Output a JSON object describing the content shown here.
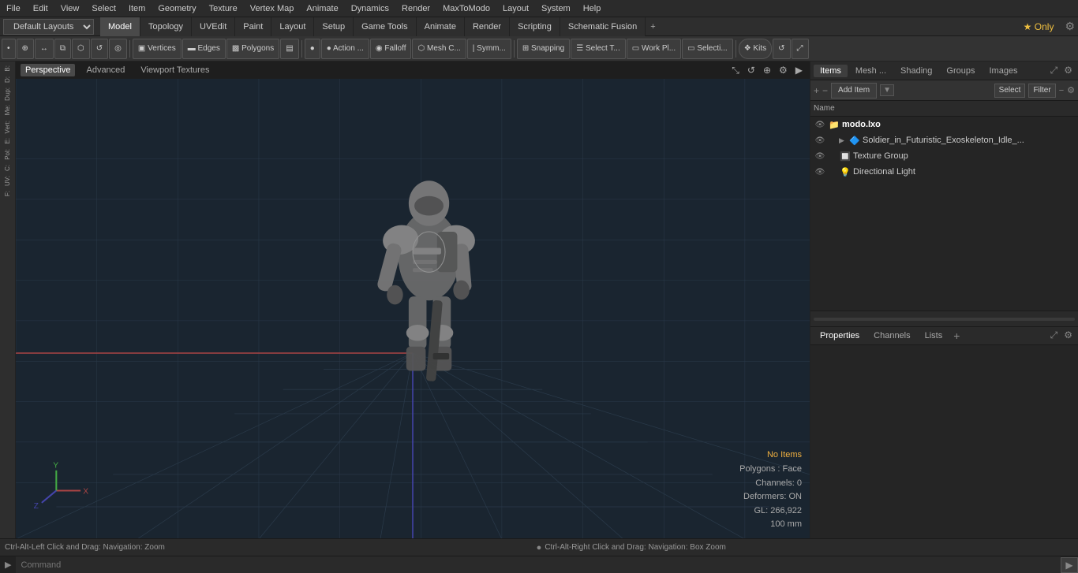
{
  "menubar": {
    "items": [
      "File",
      "Edit",
      "View",
      "Select",
      "Item",
      "Geometry",
      "Texture",
      "Vertex Map",
      "Animate",
      "Dynamics",
      "Render",
      "MaxToModo",
      "Layout",
      "System",
      "Help"
    ]
  },
  "layoutbar": {
    "dropdown_label": "Default Layouts",
    "tabs": [
      "Model",
      "Topology",
      "UVEdit",
      "Paint",
      "Layout",
      "Setup",
      "Game Tools",
      "Animate",
      "Render",
      "Scripting",
      "Schematic Fusion"
    ],
    "active_tab": "Model",
    "star_label": "★ Only",
    "plus_label": "+"
  },
  "toolbar": {
    "buttons": [
      {
        "label": "•",
        "icon": "dot"
      },
      {
        "label": "⊕",
        "icon": "crosshair"
      },
      {
        "label": "⋯",
        "icon": "dots"
      },
      {
        "label": "⧉",
        "icon": "box-select"
      },
      {
        "label": "⬡",
        "icon": "hex"
      },
      {
        "label": "⟳",
        "icon": "rotate"
      },
      {
        "label": "⬤",
        "icon": "circle"
      },
      {
        "label": "▣ Vertices",
        "icon": "vertices",
        "active": false
      },
      {
        "label": "▬ Edges",
        "icon": "edges",
        "active": false
      },
      {
        "label": "▩ Polygons",
        "icon": "polygons",
        "active": false
      },
      {
        "label": "▤",
        "icon": "quad"
      },
      {
        "label": "●",
        "icon": "dot2"
      },
      {
        "label": "● Action ...",
        "icon": "action"
      },
      {
        "label": "◉ Falloff",
        "icon": "falloff"
      },
      {
        "label": "⬡ Mesh C...",
        "icon": "mesh"
      },
      {
        "label": "| Symm...",
        "icon": "symmetry"
      },
      {
        "label": "⊞ Snapping",
        "icon": "snapping"
      },
      {
        "label": "☰ Select T...",
        "icon": "select-t"
      },
      {
        "label": "▭ Work Pl...",
        "icon": "workplane"
      },
      {
        "label": "▭ Selecti...",
        "icon": "selection"
      },
      {
        "label": "❖ Kits",
        "icon": "kits"
      },
      {
        "label": "⟳",
        "icon": "rotate2"
      },
      {
        "label": "⤢",
        "icon": "maximize"
      }
    ]
  },
  "left_toolbar": {
    "items": [
      "B:",
      "D:",
      "Dup:",
      "Me:",
      "Vert:",
      "E:",
      "Pol:",
      "C:",
      "UV:",
      "F:"
    ]
  },
  "viewport": {
    "tabs": [
      "Perspective",
      "Advanced",
      "Viewport Textures"
    ],
    "active_tab": "Perspective",
    "status": {
      "no_items": "No Items",
      "polygons": "Polygons : Face",
      "channels": "Channels: 0",
      "deformers": "Deformers: ON",
      "gl": "GL: 266,922",
      "size": "100 mm"
    }
  },
  "items_panel": {
    "tabs": [
      "Items",
      "Mesh ...",
      "Shading",
      "Groups",
      "Images"
    ],
    "active_tab": "Items",
    "add_item_label": "Add Item",
    "select_label": "Select",
    "filter_label": "Filter",
    "col_header": "Name",
    "items": [
      {
        "id": 1,
        "indent": 0,
        "has_arrow": false,
        "icon": "📁",
        "name": "modo.lxo",
        "bold": true,
        "eye": true
      },
      {
        "id": 2,
        "indent": 1,
        "has_arrow": true,
        "icon": "🔷",
        "name": "Soldier_in_Futuristic_Exoskeleton_Idle_...",
        "bold": false,
        "eye": true
      },
      {
        "id": 3,
        "indent": 1,
        "has_arrow": false,
        "icon": "🔲",
        "name": "Texture Group",
        "bold": false,
        "eye": true
      },
      {
        "id": 4,
        "indent": 1,
        "has_arrow": false,
        "icon": "💡",
        "name": "Directional Light",
        "bold": false,
        "eye": true
      }
    ]
  },
  "properties_panel": {
    "tabs": [
      "Properties",
      "Channels",
      "Lists"
    ],
    "active_tab": "Properties",
    "plus_label": "+"
  },
  "statusbar": {
    "text": "Ctrl-Alt-Left Click and Drag: Navigation: Zoom",
    "dot": "●",
    "text2": "Ctrl-Alt-Right Click and Drag: Navigation: Box Zoom"
  },
  "commandbar": {
    "arrow": "▶",
    "placeholder": "Command",
    "run_icon": "▶"
  },
  "colors": {
    "accent_green": "#6a9a6a",
    "axis_x": "#aa4444",
    "axis_z": "#4444aa",
    "axis_y": "#44aa44",
    "no_items": "#f0b040"
  }
}
